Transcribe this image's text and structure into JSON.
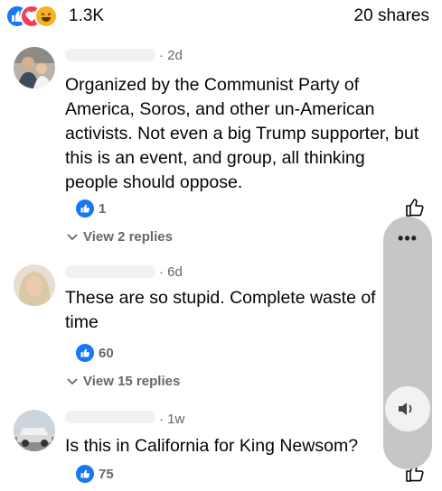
{
  "header": {
    "reaction_icons": [
      "like-reaction-icon",
      "love-reaction-icon",
      "haha-reaction-icon"
    ],
    "reaction_count": "1.3K",
    "shares": "20 shares"
  },
  "comments": [
    {
      "time": "· 2d",
      "text": "Organized by the Communist Party of America, Soros, and other un-American activists. Not even a big Trump supporter, but this is an event, and group, all thinking people should oppose.",
      "likes": "1",
      "replies": "View 2 replies"
    },
    {
      "time": "· 6d",
      "text": "These are so stupid. Complete waste of time",
      "likes": "60",
      "replies": "View 15 replies"
    },
    {
      "time": "· 1w",
      "text": "Is this in California for King Newsom?",
      "likes": "75"
    }
  ],
  "overlay": {
    "menu_label": "•••",
    "icon": "volume-icon"
  },
  "colors": {
    "like_blue": "#1877f2",
    "love_red": "#f33e58",
    "haha_yellow": "#f7b125",
    "meta_gray": "#65676b"
  }
}
